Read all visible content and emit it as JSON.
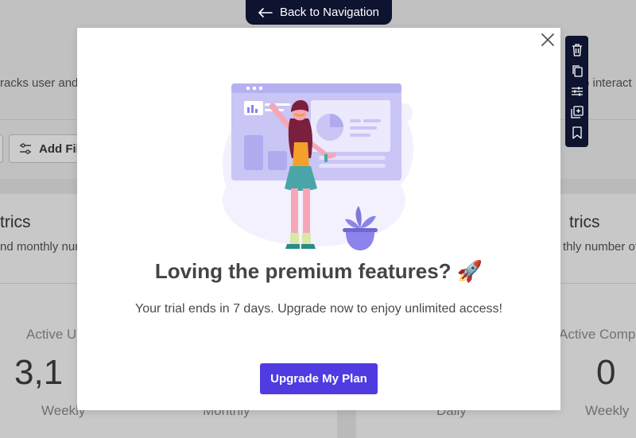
{
  "back_nav": {
    "label": "Back to Navigation",
    "icon": "arrow-left-icon"
  },
  "background": {
    "header_desc_left": "racks user and",
    "header_desc_right": "o interact",
    "add_filter_label": "Add Filter",
    "card_left": {
      "heading": "trics",
      "desc": "nd monthly num"
    },
    "card_right": {
      "heading": "trics",
      "desc": "thly number of"
    },
    "stats": [
      {
        "label": "Active U",
        "value": "3,1",
        "sub": "Weekly"
      },
      {
        "label": "",
        "value": "",
        "sub": "Monthly"
      },
      {
        "label": "",
        "value": "",
        "sub": "Daily"
      },
      {
        "label": "Active Compa",
        "value": "0",
        "sub": "Weekly"
      }
    ]
  },
  "side_toolbar": {
    "icons": [
      "trash-icon",
      "copy-icon",
      "sliders-icon",
      "duplicate-icon",
      "bookmark-icon"
    ]
  },
  "modal": {
    "title": "Loving the premium features? 🚀",
    "subtitle": "Your trial ends in 7 days. Upgrade now to enjoy unlimited access!",
    "cta_label": "Upgrade My Plan"
  },
  "colors": {
    "accent": "#4f3be0",
    "dark_navy": "#0e1330",
    "illustration_lavender": "#c9c5f5"
  }
}
